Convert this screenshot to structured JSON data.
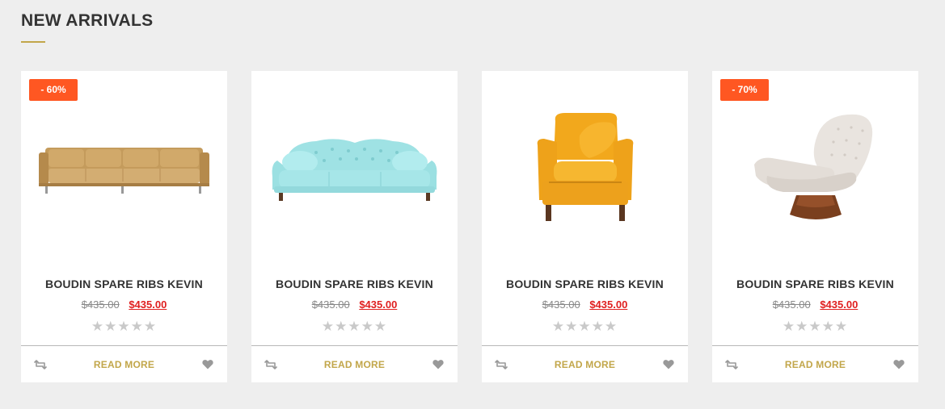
{
  "section": {
    "title": "NEW ARRIVALS"
  },
  "colors": {
    "accent": "#c2a64a",
    "badge": "#ff5722",
    "sale_price": "#e02020"
  },
  "products": [
    {
      "badge": "- 60%",
      "name": "BOUDIN SPARE RIBS KEVIN",
      "old_price": "$435.00",
      "price": "$435.00",
      "rating": 0,
      "stars": "★★★★★",
      "read_more": "READ MORE",
      "image": "tan-sofa"
    },
    {
      "badge": null,
      "name": "BOUDIN SPARE RIBS KEVIN",
      "old_price": "$435.00",
      "price": "$435.00",
      "rating": 0,
      "stars": "★★★★★",
      "read_more": "READ MORE",
      "image": "turquoise-tufted-sofa"
    },
    {
      "badge": null,
      "name": "BOUDIN SPARE RIBS KEVIN",
      "old_price": "$435.00",
      "price": "$435.00",
      "rating": 0,
      "stars": "★★★★★",
      "read_more": "READ MORE",
      "image": "yellow-armchair"
    },
    {
      "badge": "- 70%",
      "name": "BOUDIN SPARE RIBS KEVIN",
      "old_price": "$435.00",
      "price": "$435.00",
      "rating": 0,
      "stars": "★★★★★",
      "read_more": "READ MORE",
      "image": "white-lounge-chair"
    }
  ]
}
